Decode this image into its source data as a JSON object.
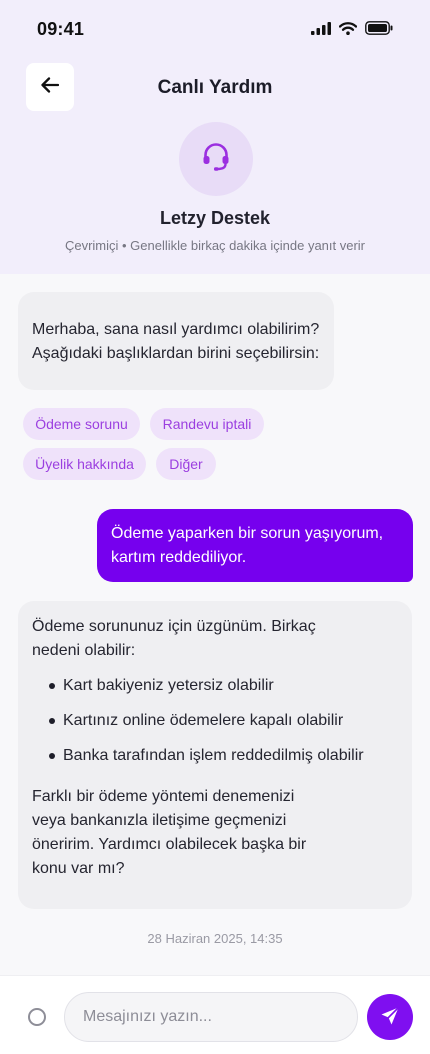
{
  "status_bar": {
    "time": "09:41"
  },
  "header": {
    "title": "Canlı Yardım",
    "agent_name": "Letzy Destek",
    "agent_status": "Çevrimiçi • Genellikle birkaç dakika içinde yanıt verir"
  },
  "messages": {
    "greeting": {
      "line1": "Merhaba, sana nasıl yardımcı olabilirim?",
      "line2": "Aşağıdaki başlıklardan birini seçebilirsin:"
    },
    "quick_replies": [
      "Ödeme sorunu",
      "Randevu iptali",
      "Üyelik hakkında",
      "Diğer"
    ],
    "user": {
      "line1": "Ödeme yaparken bir sorun yaşıyorum,",
      "line2": "kartım reddediliyor."
    },
    "reply": {
      "intro_line1": "Ödeme sorununuz için üzgünüm. Birkaç",
      "intro_line2": "nedeni olabilir:",
      "bullets": [
        "Kart bakiyeniz yetersiz olabilir",
        "Kartınız online ödemelere kapalı olabilir",
        "Banka tarafından işlem reddedilmiş olabilir"
      ],
      "closing_line1": "Farklı bir ödeme yöntemi denemenizi",
      "closing_line2": "veya bankanızla iletişime geçmenizi",
      "closing_line3": "öneririm. Yardımcı olabilecek başka bir",
      "closing_line4": "konu var mı?"
    },
    "timestamp": "28 Haziran 2025, 14:35"
  },
  "input": {
    "placeholder": "Mesajınızı yazın...",
    "value": ""
  },
  "icons": {
    "back": "arrow-left-icon",
    "agent": "headset-icon",
    "send": "send-icon",
    "attach": "circle-icon",
    "signal": "cellular-signal-icon",
    "wifi": "wifi-icon",
    "battery": "battery-icon"
  },
  "colors": {
    "accent": "#7600ee",
    "header_bg": "#f2eefb",
    "chip_bg": "#efe2fa",
    "chip_text": "#9b3fe0",
    "incoming_bubble": "#efeff2"
  }
}
